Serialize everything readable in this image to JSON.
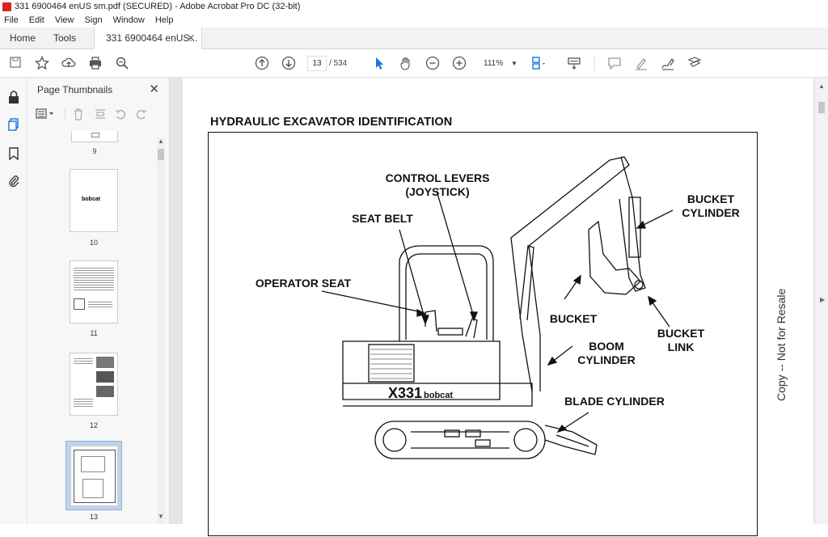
{
  "window": {
    "title": "331 6900464 enUS sm.pdf (SECURED) - Adobe Acrobat Pro DC (32-bit)"
  },
  "menu": [
    "File",
    "Edit",
    "View",
    "Sign",
    "Window",
    "Help"
  ],
  "tabs": {
    "home": "Home",
    "tools": "Tools",
    "document": "331 6900464 enUS...",
    "close": "✕"
  },
  "toolbar": {
    "current_page": "13",
    "page_total": "/  534",
    "zoom": "111%"
  },
  "thumbnails": {
    "title": "Page Thumbnails",
    "close": "✕",
    "pages": [
      {
        "label": "9"
      },
      {
        "label": "10"
      },
      {
        "label": "11"
      },
      {
        "label": "12"
      },
      {
        "label": "13",
        "selected": true
      }
    ]
  },
  "document": {
    "heading": "HYDRAULIC EXCAVATOR IDENTIFICATION",
    "callouts": {
      "control_levers": "CONTROL LEVERS\n(JOYSTICK)",
      "seat_belt": "SEAT BELT",
      "operator_seat": "OPERATOR SEAT",
      "bucket_cylinder": "BUCKET\nCYLINDER",
      "bucket": "BUCKET",
      "bucket_link": "BUCKET\nLINK",
      "boom_cylinder": "BOOM\nCYLINDER",
      "blade_cylinder": "BLADE CYLINDER"
    },
    "machine_label": "X331",
    "brand_label": "bobcat",
    "watermark": "Copy -- Not for Resale"
  },
  "colors": {
    "accent": "#1473e6",
    "pdf_red": "#d9251d"
  }
}
